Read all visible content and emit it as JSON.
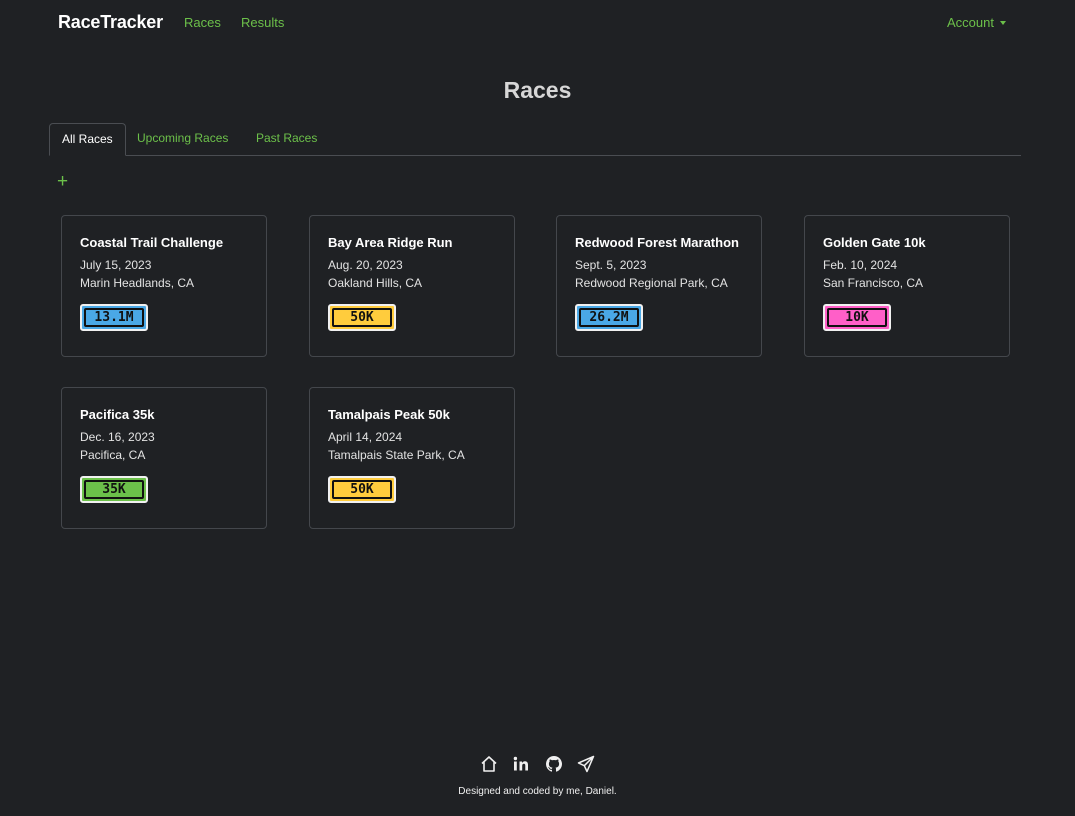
{
  "nav": {
    "brand": "RaceTracker",
    "links": [
      "Races",
      "Results"
    ],
    "account": "Account"
  },
  "page": {
    "title": "Races"
  },
  "tabs": [
    {
      "label": "All Races",
      "active": true
    },
    {
      "label": "Upcoming Races",
      "active": false
    },
    {
      "label": "Past Races",
      "active": false
    }
  ],
  "add_button": "+",
  "races": [
    {
      "name": "Coastal Trail Challenge",
      "date": "July 15, 2023",
      "location": "Marin Headlands, CA",
      "distance": "13.1M",
      "badge_color": "#4aa8e6"
    },
    {
      "name": "Bay Area Ridge Run",
      "date": "Aug. 20, 2023",
      "location": "Oakland Hills, CA",
      "distance": "50K",
      "badge_color": "#ffcc3d"
    },
    {
      "name": "Redwood Forest Marathon",
      "date": "Sept. 5, 2023",
      "location": "Redwood Regional Park, CA",
      "distance": "26.2M",
      "badge_color": "#4aa8e6"
    },
    {
      "name": "Golden Gate 10k",
      "date": "Feb. 10, 2024",
      "location": "San Francisco, CA",
      "distance": "10K",
      "badge_color": "#ff5fc8"
    },
    {
      "name": "Pacifica 35k",
      "date": "Dec. 16, 2023",
      "location": "Pacifica, CA",
      "distance": "35K",
      "badge_color": "#6cc04a"
    },
    {
      "name": "Tamalpais Peak 50k",
      "date": "April 14, 2024",
      "location": "Tamalpais State Park, CA",
      "distance": "50K",
      "badge_color": "#ffcc3d"
    }
  ],
  "footer": {
    "icons": [
      "home-icon",
      "linkedin-icon",
      "github-icon",
      "send-icon"
    ],
    "credit": "Designed and coded by me, Daniel."
  }
}
